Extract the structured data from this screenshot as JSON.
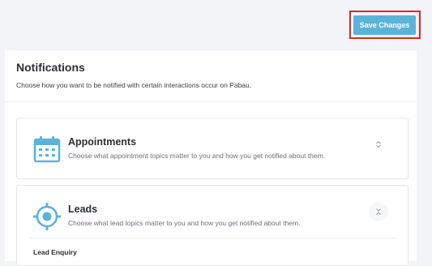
{
  "header": {
    "save_button_label": "Save Changes"
  },
  "notifications": {
    "title": "Notifications",
    "subtitle": "Choose how you want to be notified with certain interactions occur on Pabau."
  },
  "sections": [
    {
      "title": "Appointments",
      "description": "Choose what appointment topics matter to you and how you get notified about them.",
      "icon": "calendar-icon",
      "expanded": false
    },
    {
      "title": "Leads",
      "description": "Choose what lead topics matter to you and how you get notified about them.",
      "icon": "target-icon",
      "expanded": true,
      "subsection_title": "Lead Enquiry"
    }
  ],
  "colors": {
    "accent": "#5bb4d7",
    "highlight": "#e02626",
    "background": "#f3f4f7"
  }
}
